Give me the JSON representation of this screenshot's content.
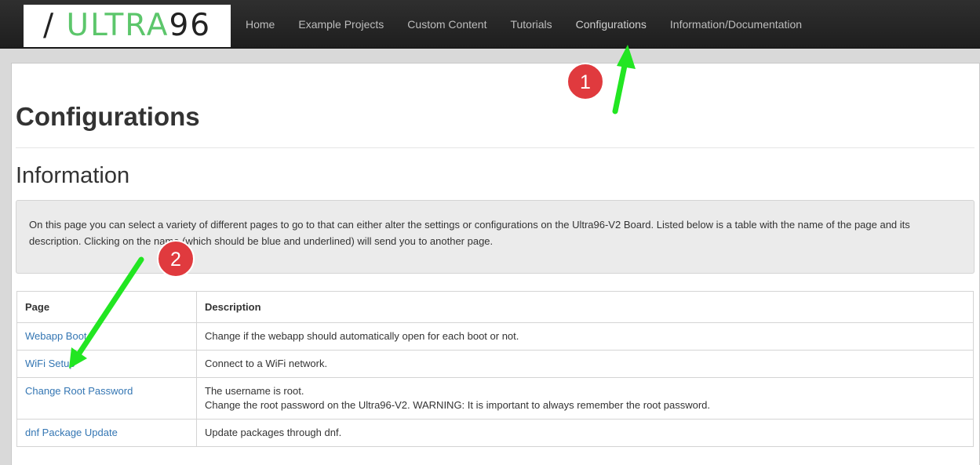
{
  "logo": {
    "slash": "/",
    "ultra": "ULTRA",
    "num": "96"
  },
  "nav": {
    "items": [
      {
        "label": "Home"
      },
      {
        "label": "Example Projects"
      },
      {
        "label": "Custom Content"
      },
      {
        "label": "Tutorials"
      },
      {
        "label": "Configurations"
      },
      {
        "label": "Information/Documentation"
      }
    ]
  },
  "page": {
    "title": "Configurations",
    "section_title": "Information",
    "info_text": "On this page you can select a variety of different pages to go to that can either alter the settings or configurations on the Ultra96-V2 Board. Listed below is a table with the name of the page and its description. Clicking on the name (which should be blue and underlined) will send you to another page."
  },
  "table": {
    "headers": [
      "Page",
      "Description"
    ],
    "rows": [
      {
        "page": "Webapp Boot",
        "description": [
          "Change if the webapp should automatically open for each boot or not."
        ]
      },
      {
        "page": "WiFi Setup",
        "description": [
          "Connect to a WiFi network."
        ]
      },
      {
        "page": "Change Root Password",
        "description": [
          "The username is root.",
          "Change the root password on the Ultra96-V2. WARNING: It is important to always remember the root password."
        ]
      },
      {
        "page": "dnf Package Update",
        "description": [
          "Update packages through dnf."
        ]
      }
    ]
  },
  "annotations": {
    "badge_1": "1",
    "badge_2": "2",
    "badge_color": "#e03a3e",
    "arrow_color": "#22e622"
  }
}
